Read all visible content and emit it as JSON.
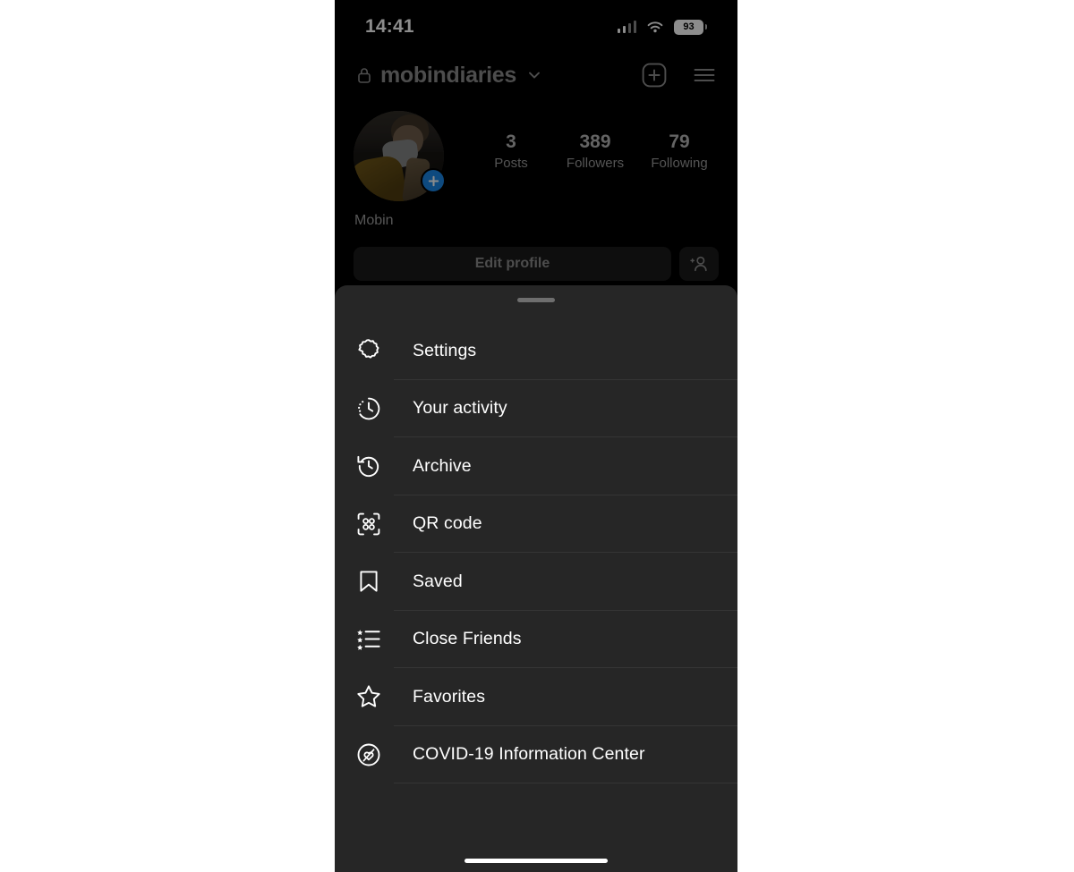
{
  "status_bar": {
    "time": "14:41",
    "battery_level": "93",
    "signal_icon": "cellular-signal-icon",
    "wifi_icon": "wifi-icon",
    "battery_icon": "battery-icon"
  },
  "header": {
    "lock_icon": "lock-icon",
    "username": "mobindiaries",
    "chevron_icon": "chevron-down-icon",
    "new_post_icon": "plus-square-icon",
    "menu_icon": "hamburger-menu-icon"
  },
  "profile": {
    "avatar_name": "profile-avatar",
    "add_story_icon": "plus-badge-icon",
    "display_name": "Mobin",
    "stats": [
      {
        "value": "3",
        "label": "Posts"
      },
      {
        "value": "389",
        "label": "Followers"
      },
      {
        "value": "79",
        "label": "Following"
      }
    ],
    "edit_profile_label": "Edit profile",
    "add_person_icon": "add-person-icon"
  },
  "sheet": {
    "drag_handle": "drag-handle",
    "items": [
      {
        "label": "Settings",
        "icon": "gear-icon"
      },
      {
        "label": "Your activity",
        "icon": "activity-clock-icon"
      },
      {
        "label": "Archive",
        "icon": "archive-history-icon"
      },
      {
        "label": "QR code",
        "icon": "qr-code-icon"
      },
      {
        "label": "Saved",
        "icon": "bookmark-icon"
      },
      {
        "label": "Close Friends",
        "icon": "close-friends-star-list-icon"
      },
      {
        "label": "Favorites",
        "icon": "star-icon"
      },
      {
        "label": "COVID-19 Information Center",
        "icon": "covid-info-icon"
      }
    ]
  },
  "colors": {
    "page_background": "#000000",
    "sheet_background": "#262626",
    "accent_blue": "#1b87e8",
    "divider": "#353535",
    "primary_text": "#ffffff",
    "dimmed_text": "#8c8c8c"
  }
}
